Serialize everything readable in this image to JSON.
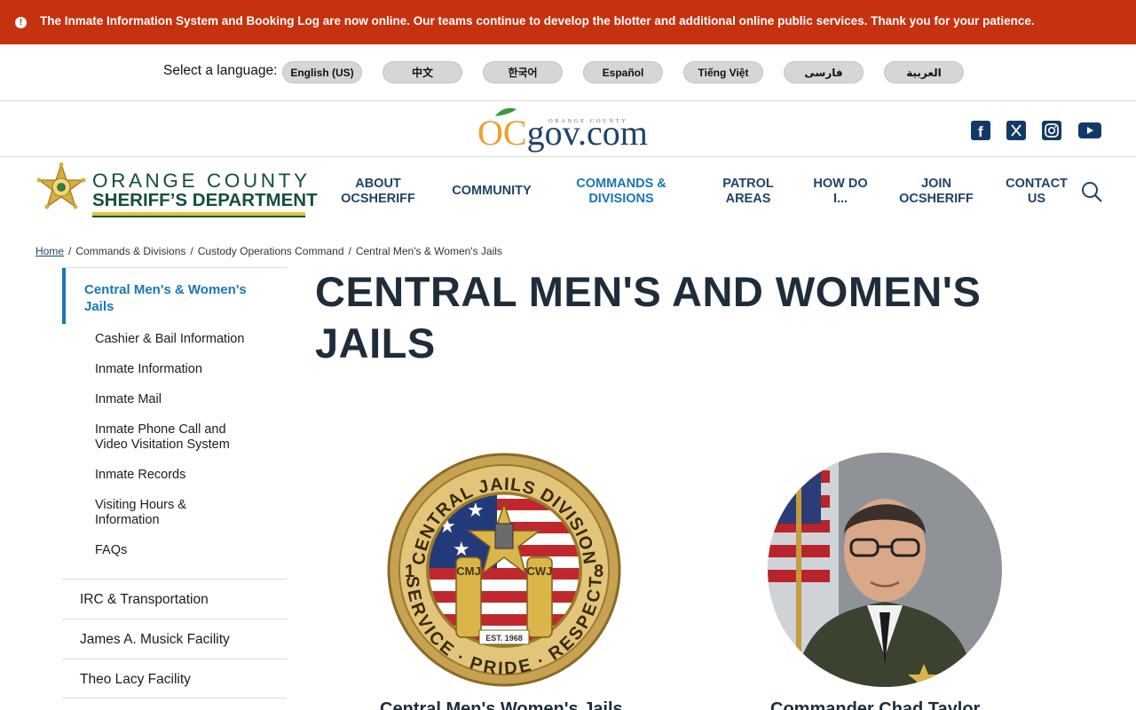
{
  "alert": {
    "text": "The Inmate Information System and Booking Log are now online. Our teams continue to develop the blotter and additional online public services. Thank you for your patience."
  },
  "language": {
    "label": "Select a language:",
    "options": [
      "English (US)",
      "中文",
      "한국어",
      "Español",
      "Tiếng Việt",
      "فارسی",
      "العربية"
    ]
  },
  "govbar": {
    "logo_small": "ORANGE COUNTY",
    "logo_o": "O",
    "logo_c": "C",
    "logo_rest": "gov.com",
    "social": [
      "facebook-icon",
      "x-icon",
      "instagram-icon",
      "youtube-icon"
    ]
  },
  "header": {
    "logo_line1": "ORANGE COUNTY",
    "logo_line2": "SHERIFF’S DEPARTMENT",
    "nav": [
      {
        "line1": "ABOUT",
        "line2": "OCSHERIFF"
      },
      {
        "line1": "COMMUNITY",
        "line2": ""
      },
      {
        "line1": "COMMANDS &",
        "line2": "DIVISIONS"
      },
      {
        "line1": "PATROL",
        "line2": "AREAS"
      },
      {
        "line1": "HOW DO",
        "line2": "I..."
      },
      {
        "line1": "JOIN",
        "line2": "OCSHERIFF"
      },
      {
        "line1": "CONTACT",
        "line2": "US"
      }
    ]
  },
  "breadcrumb": {
    "items": [
      "Home",
      "Commands & Divisions",
      "Custody Operations Command",
      "Central Men's & Women's Jails"
    ]
  },
  "sidebar": {
    "current": "Central Men's & Women's Jails",
    "subitems": [
      "Cashier & Bail Information",
      "Inmate Information",
      "Inmate Mail",
      "Inmate Phone Call and Video Visitation System",
      "Inmate Records",
      "Visiting Hours & Information",
      "FAQs"
    ],
    "items": [
      "IRC & Transportation",
      "James A. Musick Facility",
      "Theo Lacy Facility"
    ]
  },
  "main": {
    "title": "CENTRAL MEN'S AND WOMEN'S JAILS",
    "badge": {
      "top_text": "CENTRAL JAILS DIVISION",
      "bottom_text": "SERVICE · PRIDE · RESPECT",
      "left_num": "1",
      "right_num": "8",
      "key_left": "CMJ",
      "key_right": "CWJ",
      "est": "EST. 1968"
    },
    "card1_title": "Central Men's Women's Jails",
    "card2_title": "Commander Chad Taylor"
  },
  "colors": {
    "alert_bg": "#c6310f",
    "brand_green": "#14503a",
    "brand_gold": "#e5c339",
    "nav_blue": "#1f4468",
    "accent_blue": "#1b76b4"
  }
}
